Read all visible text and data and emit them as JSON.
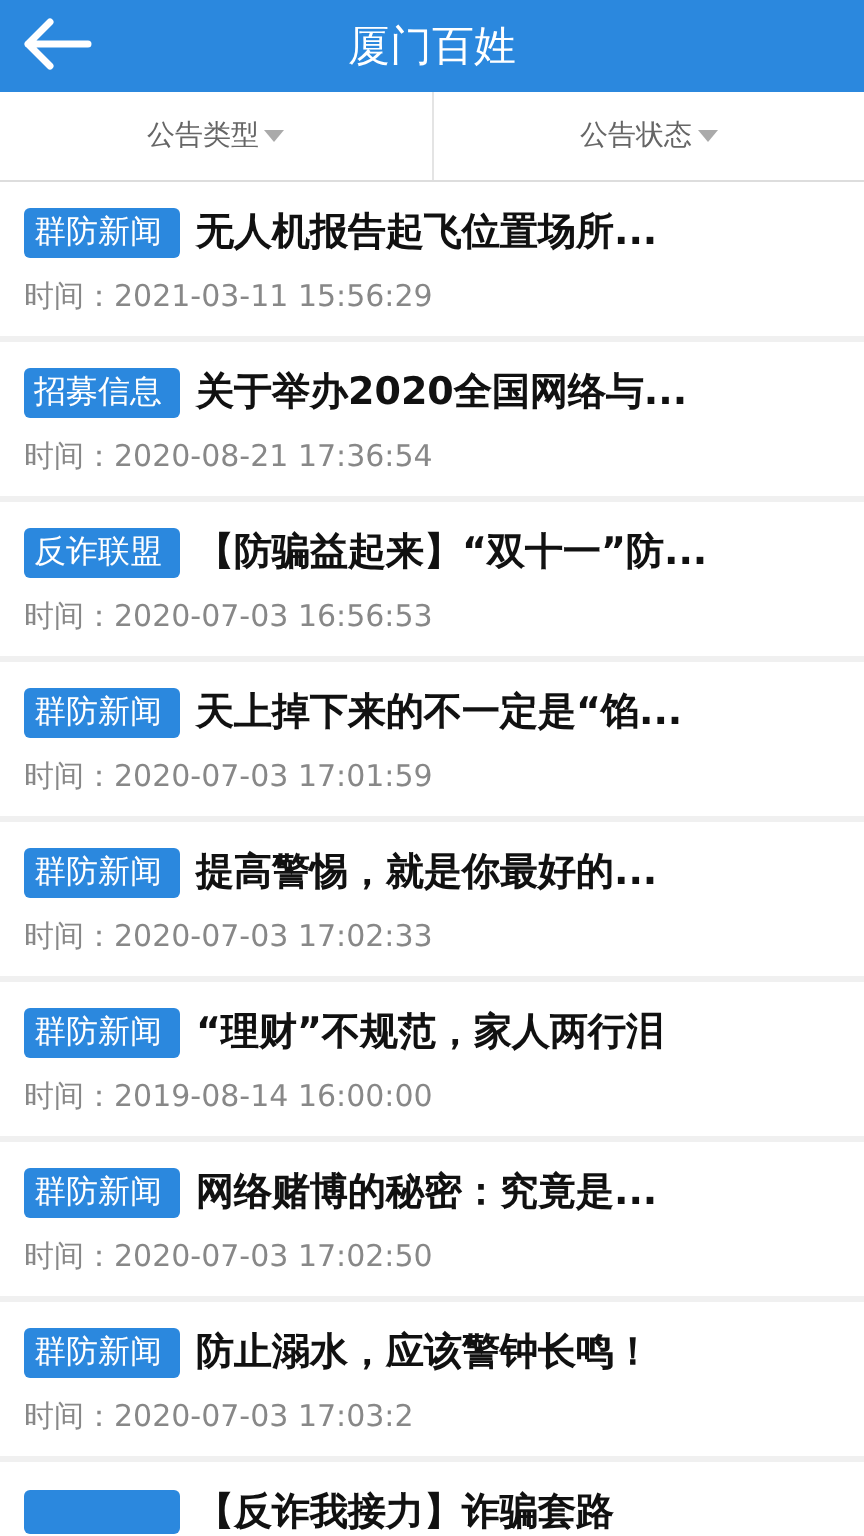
{
  "header": {
    "title": "厦门百姓"
  },
  "filters": [
    {
      "label": "公告类型"
    },
    {
      "label": "公告状态"
    }
  ],
  "items": [
    {
      "tag": "群防新闻",
      "title": "无人机报告起飞位置场所...",
      "time_label": "时间：",
      "time": "2021-03-11 15:56:29"
    },
    {
      "tag": "招募信息",
      "title": "关于举办2020全国网络与...",
      "time_label": "时间：",
      "time": "2020-08-21 17:36:54"
    },
    {
      "tag": "反诈联盟",
      "title": "【防骗益起来】“双十一”防...",
      "time_label": "时间：",
      "time": "2020-07-03 16:56:53"
    },
    {
      "tag": "群防新闻",
      "title": "天上掉下来的不一定是“馅...",
      "time_label": "时间：",
      "time": "2020-07-03 17:01:59"
    },
    {
      "tag": "群防新闻",
      "title": "提高警惕，就是你最好的...",
      "time_label": "时间：",
      "time": "2020-07-03 17:02:33"
    },
    {
      "tag": "群防新闻",
      "title": "“理财”不规范，家人两行泪",
      "time_label": "时间：",
      "time": "2019-08-14 16:00:00"
    },
    {
      "tag": "群防新闻",
      "title": "网络赌博的秘密：究竟是...",
      "time_label": "时间：",
      "time": "2020-07-03 17:02:50"
    },
    {
      "tag": "群防新闻",
      "title": "防止溺水，应该警钟长鸣！",
      "time_label": "时间：",
      "time": "2020-07-03 17:03:2"
    },
    {
      "title": "【反诈我接力】诈骗套路"
    }
  ]
}
